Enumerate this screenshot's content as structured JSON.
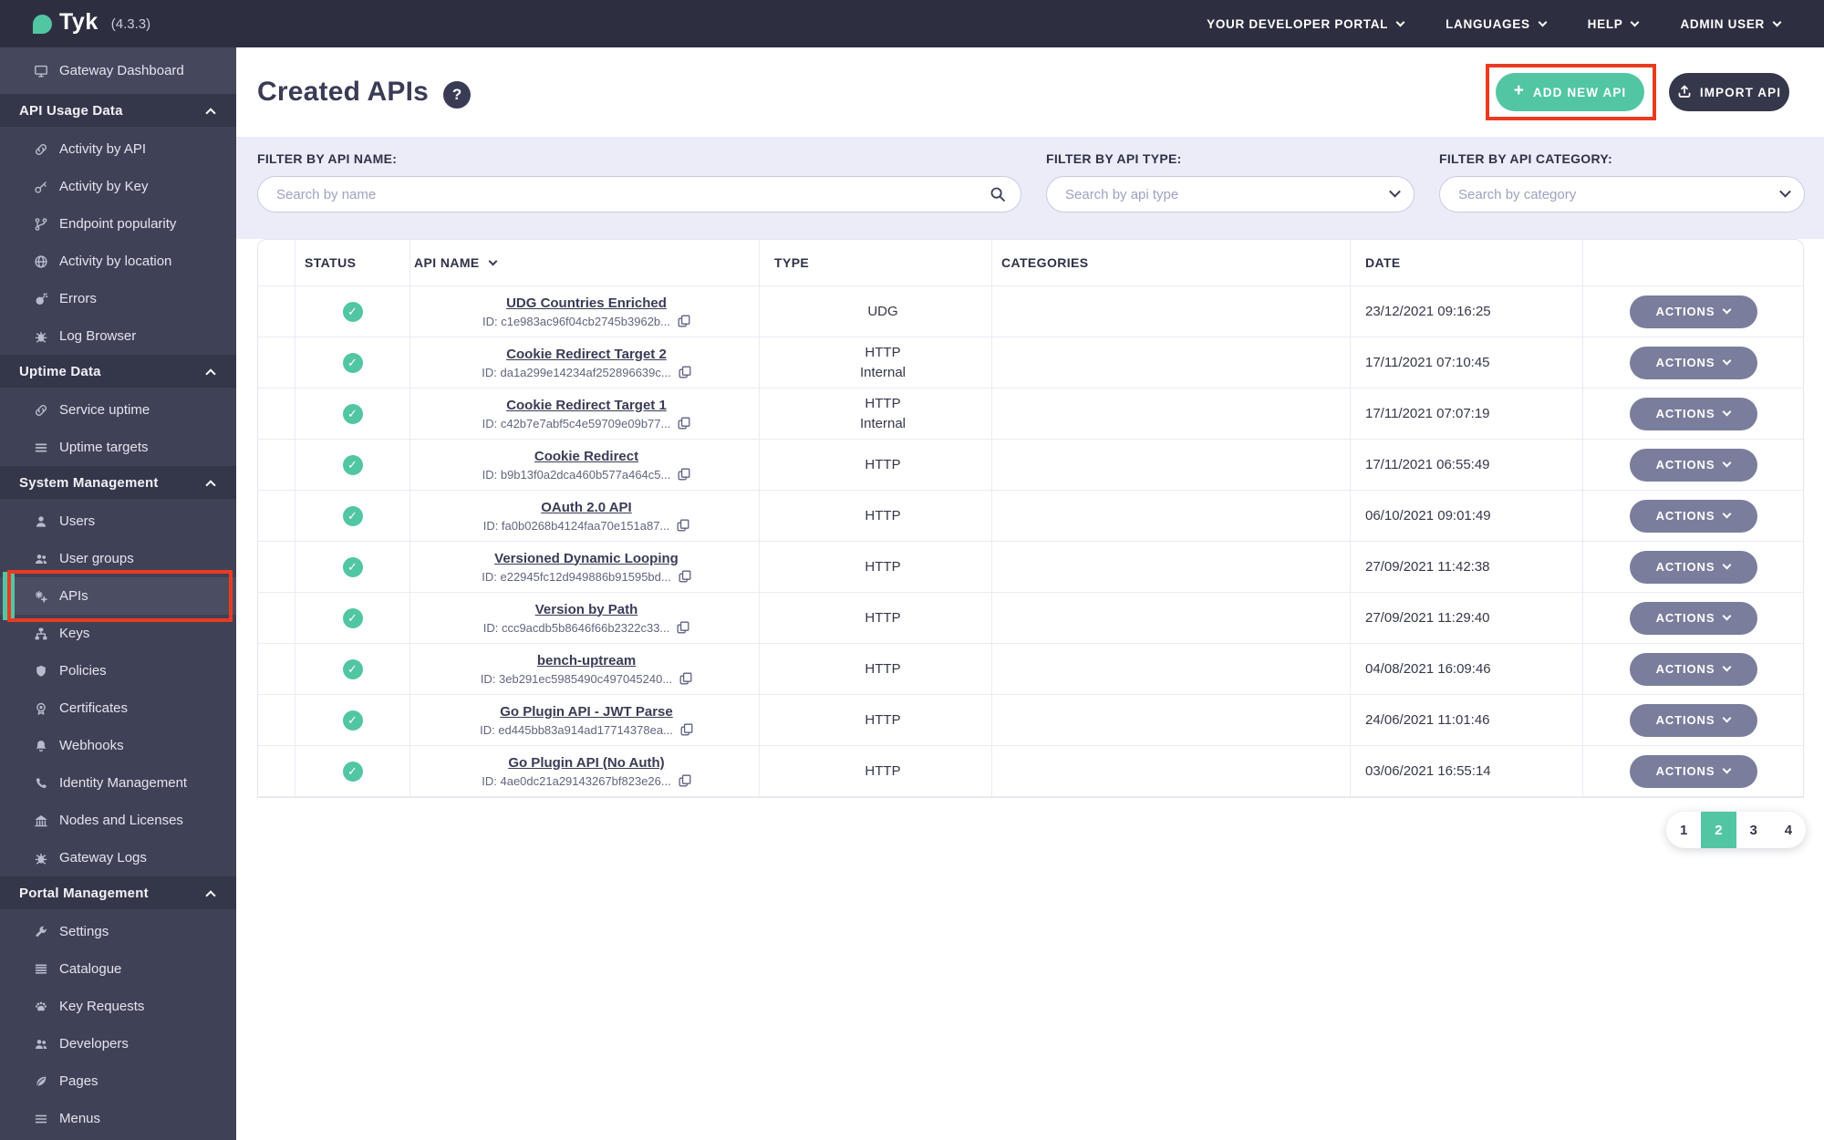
{
  "colors": {
    "accent_teal": "#52C6A2",
    "topbar_bg": "#2D2F40",
    "sidebar_bg": "#3F4156",
    "sidebar_section_bg": "#343649",
    "sidebar_active_bg": "#4B4D63",
    "filter_panel_bg": "#EBECF8",
    "actions_button_bg": "#7A7E9C",
    "dark_button_bg": "#35374A",
    "annotation_red": "#E83B22",
    "text_dark": "#35374A",
    "text_muted": "#62657F",
    "placeholder": "#9EA2C0"
  },
  "glyphs": {
    "check": "✓",
    "help": "?",
    "plus": "+"
  },
  "topbar": {
    "brand": "Tyk",
    "version": "(4.3.3)",
    "menu": [
      {
        "label": "YOUR DEVELOPER PORTAL"
      },
      {
        "label": "LANGUAGES"
      },
      {
        "label": "HELP"
      },
      {
        "label": "ADMIN USER"
      }
    ]
  },
  "sidebar": {
    "top_item": {
      "label": "Gateway Dashboard",
      "icon": "monitor"
    },
    "sections": [
      {
        "label": "API Usage Data",
        "expanded": true,
        "items": [
          {
            "label": "Activity by API",
            "icon": "link"
          },
          {
            "label": "Activity by Key",
            "icon": "key"
          },
          {
            "label": "Endpoint popularity",
            "icon": "branch"
          },
          {
            "label": "Activity by location",
            "icon": "globe"
          },
          {
            "label": "Errors",
            "icon": "bomb"
          },
          {
            "label": "Log Browser",
            "icon": "bug"
          }
        ]
      },
      {
        "label": "Uptime Data",
        "expanded": true,
        "items": [
          {
            "label": "Service uptime",
            "icon": "link"
          },
          {
            "label": "Uptime targets",
            "icon": "list"
          }
        ]
      },
      {
        "label": "System Management",
        "expanded": true,
        "items": [
          {
            "label": "Users",
            "icon": "user"
          },
          {
            "label": "User groups",
            "icon": "users"
          },
          {
            "label": "APIs",
            "icon": "gears",
            "active": true
          },
          {
            "label": "Keys",
            "icon": "sitemap"
          },
          {
            "label": "Policies",
            "icon": "shield"
          },
          {
            "label": "Certificates",
            "icon": "certificate"
          },
          {
            "label": "Webhooks",
            "icon": "bell"
          },
          {
            "label": "Identity Management",
            "icon": "phone"
          },
          {
            "label": "Nodes and Licenses",
            "icon": "bank"
          },
          {
            "label": "Gateway Logs",
            "icon": "bug"
          }
        ]
      },
      {
        "label": "Portal Management",
        "expanded": true,
        "items": [
          {
            "label": "Settings",
            "icon": "wrench"
          },
          {
            "label": "Catalogue",
            "icon": "catalogue"
          },
          {
            "label": "Key Requests",
            "icon": "paw"
          },
          {
            "label": "Developers",
            "icon": "users"
          },
          {
            "label": "Pages",
            "icon": "leaf"
          },
          {
            "label": "Menus",
            "icon": "bars"
          }
        ]
      }
    ]
  },
  "main": {
    "title": "Created APIs",
    "buttons": {
      "add_label": "ADD NEW API",
      "import_label": "IMPORT API"
    },
    "filters": [
      {
        "label": "FILTER BY API NAME:",
        "placeholder": "Search by name",
        "kind": "search"
      },
      {
        "label": "FILTER BY API TYPE:",
        "placeholder": "Search by api type",
        "kind": "select"
      },
      {
        "label": "FILTER BY API CATEGORY:",
        "placeholder": "Search by category",
        "kind": "select"
      }
    ],
    "table": {
      "columns": [
        "STATUS",
        "API NAME",
        "TYPE",
        "CATEGORIES",
        "DATE"
      ],
      "actions_label": "ACTIONS",
      "rows": [
        {
          "status": "active",
          "name": "UDG Countries Enriched",
          "id": "ID: c1e983ac96f04cb2745b3962b...",
          "type": [
            "UDG"
          ],
          "categories": "",
          "date": "23/12/2021 09:16:25"
        },
        {
          "status": "active",
          "name": "Cookie Redirect Target 2",
          "id": "ID: da1a299e14234af252896639c...",
          "type": [
            "HTTP",
            "Internal"
          ],
          "categories": "",
          "date": "17/11/2021 07:10:45"
        },
        {
          "status": "active",
          "name": "Cookie Redirect Target 1",
          "id": "ID: c42b7e7abf5c4e59709e09b77...",
          "type": [
            "HTTP",
            "Internal"
          ],
          "categories": "",
          "date": "17/11/2021 07:07:19"
        },
        {
          "status": "active",
          "name": "Cookie Redirect",
          "id": "ID: b9b13f0a2dca460b577a464c5...",
          "type": [
            "HTTP"
          ],
          "categories": "",
          "date": "17/11/2021 06:55:49"
        },
        {
          "status": "active",
          "name": "OAuth 2.0 API",
          "id": "ID: fa0b0268b4124faa70e151a87...",
          "type": [
            "HTTP"
          ],
          "categories": "",
          "date": "06/10/2021 09:01:49"
        },
        {
          "status": "active",
          "name": "Versioned Dynamic Looping",
          "id": "ID: e22945fc12d949886b91595bd...",
          "type": [
            "HTTP"
          ],
          "categories": "",
          "date": "27/09/2021 11:42:38"
        },
        {
          "status": "active",
          "name": "Version by Path",
          "id": "ID: ccc9acdb5b8646f66b2322c33...",
          "type": [
            "HTTP"
          ],
          "categories": "",
          "date": "27/09/2021 11:29:40"
        },
        {
          "status": "active",
          "name": "bench-uptream",
          "id": "ID: 3eb291ec5985490c497045240...",
          "type": [
            "HTTP"
          ],
          "categories": "",
          "date": "04/08/2021 16:09:46"
        },
        {
          "status": "active",
          "name": "Go Plugin API - JWT Parse",
          "id": "ID: ed445bb83a914ad17714378ea...",
          "type": [
            "HTTP"
          ],
          "categories": "",
          "date": "24/06/2021 11:01:46"
        },
        {
          "status": "active",
          "name": "Go Plugin API (No Auth)",
          "id": "ID: 4ae0dc21a29143267bf823e26...",
          "type": [
            "HTTP"
          ],
          "categories": "",
          "date": "03/06/2021 16:55:14"
        }
      ]
    },
    "pagination": {
      "pages": [
        "1",
        "2",
        "3",
        "4"
      ],
      "active": "2"
    }
  },
  "annotations": [
    {
      "target": "sidebar-apis-item",
      "color": "#E83B22"
    },
    {
      "target": "add-new-api-button",
      "color": "#E83B22"
    }
  ]
}
